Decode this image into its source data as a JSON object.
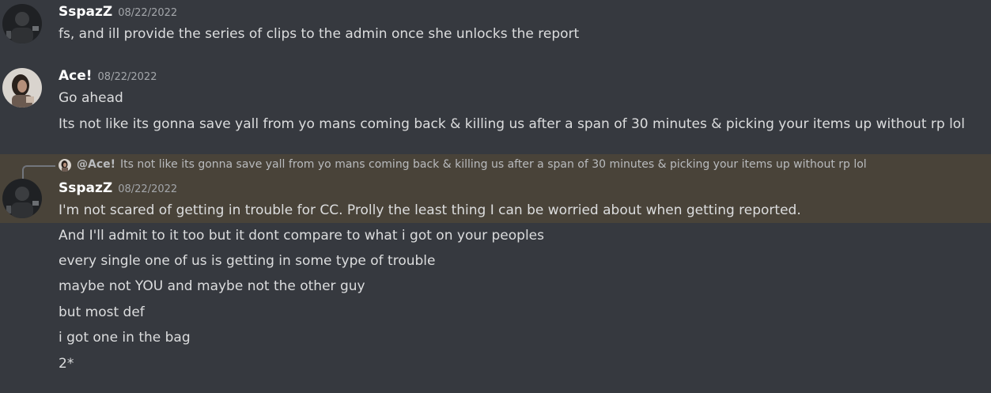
{
  "messages": [
    {
      "author": "SspazZ",
      "timestamp": "08/22/2022",
      "avatar_icon": "user-avatar-icon",
      "lines": [
        "fs, and ill provide the series of clips to the admin once she unlocks the report"
      ]
    },
    {
      "author": "Ace!",
      "timestamp": "08/22/2022",
      "avatar_icon": "user-avatar-icon",
      "lines": [
        "Go ahead",
        "Its not like its gonna save yall from yo mans coming back & killing us after a span of 30 minutes & picking your items up without rp lol"
      ]
    },
    {
      "author": "SspazZ",
      "timestamp": "08/22/2022",
      "avatar_icon": "user-avatar-icon",
      "reply": {
        "author": "@Ace!",
        "text": "Its not like its gonna save yall from yo mans coming back & killing us after a span of 30 minutes & picking your items up without rp lol"
      },
      "lines": [
        "I'm not scared of getting in trouble for CC. Prolly the least thing I can be worried about when getting reported.",
        "And I'll admit to it too but it dont compare to what i got on your peoples",
        "every single one of us is getting in some type of trouble",
        "maybe not YOU and maybe not the other guy",
        "but most def",
        "i got one in the bag",
        "2*"
      ]
    }
  ],
  "colors": {
    "background": "#36393f",
    "highlight": "#494339",
    "username": "#ffffff",
    "timestamp": "#a3a6aa",
    "text": "#dcddde"
  }
}
